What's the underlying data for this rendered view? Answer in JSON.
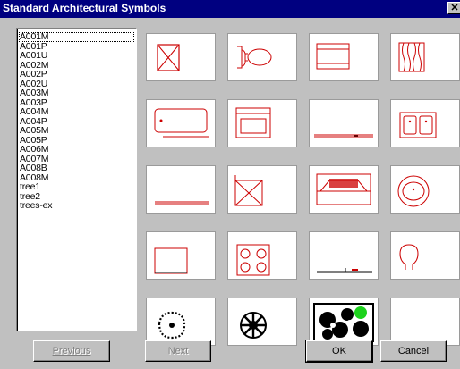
{
  "window": {
    "title": "Standard Architectural Symbols",
    "close_label": "✕"
  },
  "list": {
    "items": [
      "A001M",
      "A001P",
      "A001U",
      "A002M",
      "A002P",
      "A002U",
      "A003M",
      "A003P",
      "A004M",
      "A004P",
      "A005M",
      "A005P",
      "A006M",
      "A007M",
      "A008B",
      "A008M",
      "tree1",
      "tree2",
      "trees-ex"
    ],
    "selected_index": 0
  },
  "symbols": [
    {
      "icon": "box-with-x-icon"
    },
    {
      "icon": "toilet-icon"
    },
    {
      "icon": "cabinet-icon"
    },
    {
      "icon": "wood-grain-icon"
    },
    {
      "icon": "bathtub-icon"
    },
    {
      "icon": "range-icon"
    },
    {
      "icon": "counter-line-icon"
    },
    {
      "icon": "double-sink-icon"
    },
    {
      "icon": "counter-line-short-icon"
    },
    {
      "icon": "box-half-x-icon"
    },
    {
      "icon": "fireplace-icon"
    },
    {
      "icon": "round-sink-icon"
    },
    {
      "icon": "refrigerator-icon"
    },
    {
      "icon": "cooktop-icon"
    },
    {
      "icon": "line-with-marker-icon"
    },
    {
      "icon": "shower-head-icon"
    },
    {
      "icon": "tree-shrub-icon"
    },
    {
      "icon": "tree-leafy-icon"
    },
    {
      "icon": "trees-example-icon"
    },
    {
      "icon": "empty-slot"
    }
  ],
  "buttons": {
    "previous": "Previous",
    "next": "Next",
    "ok": "OK",
    "cancel": "Cancel"
  },
  "colors": {
    "title_bg": "#000080",
    "symbol_red": "#cc0000",
    "face": "#c0c0c0"
  }
}
